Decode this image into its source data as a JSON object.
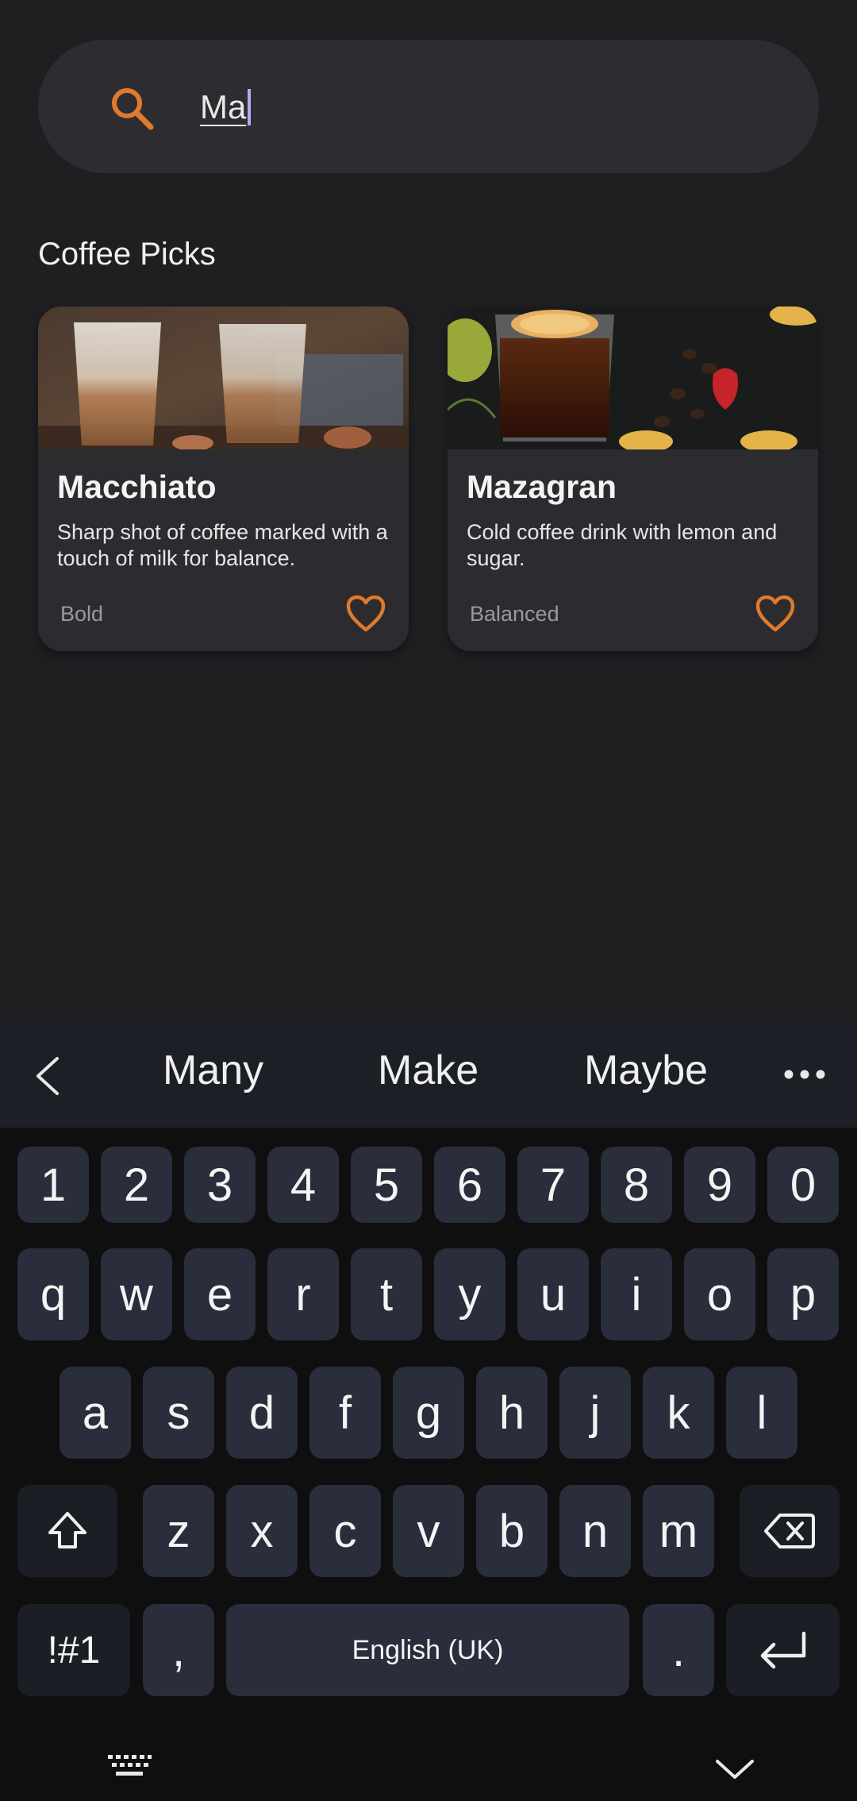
{
  "search": {
    "value": "Ma"
  },
  "section_title": "Coffee Picks",
  "cards": [
    {
      "title": "Macchiato",
      "description": "Sharp shot of coffee marked with a touch of milk for balance.",
      "tag": "Bold"
    },
    {
      "title": "Mazagran",
      "description": "Cold coffee drink with lemon and sugar.",
      "tag": "Balanced"
    }
  ],
  "keyboard": {
    "suggestions": [
      "Many",
      "Make",
      "Maybe"
    ],
    "row_numbers": [
      "1",
      "2",
      "3",
      "4",
      "5",
      "6",
      "7",
      "8",
      "9",
      "0"
    ],
    "row1": [
      "q",
      "w",
      "e",
      "r",
      "t",
      "y",
      "u",
      "i",
      "o",
      "p"
    ],
    "row2": [
      "a",
      "s",
      "d",
      "f",
      "g",
      "h",
      "j",
      "k",
      "l"
    ],
    "row3": [
      "z",
      "x",
      "c",
      "v",
      "b",
      "n",
      "m"
    ],
    "symbols_label": "!#1",
    "comma": ",",
    "space_label": "English (UK)",
    "period": "."
  },
  "colors": {
    "accent": "#e07a2c",
    "background": "#1f1f22",
    "card": "#2c2c30",
    "key": "#2a2d3b"
  },
  "icons": [
    "search-icon",
    "heart-icon",
    "chevron-left-icon",
    "more-icon",
    "shift-icon",
    "backspace-icon",
    "enter-icon",
    "keyboard-icon",
    "chevron-down-icon"
  ]
}
